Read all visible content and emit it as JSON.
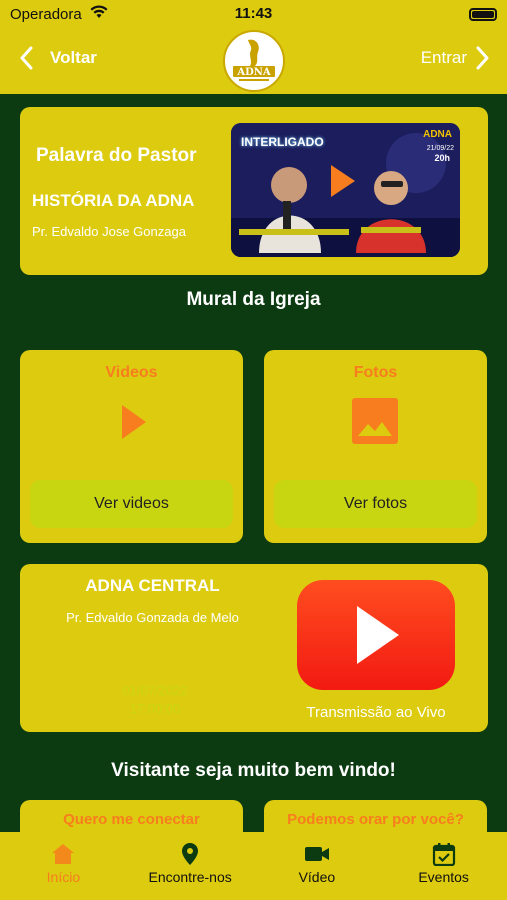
{
  "status_bar": {
    "carrier": "Operadora",
    "time": "11:43"
  },
  "header": {
    "back_label": "Voltar",
    "enter_label": "Entrar",
    "logo_text": "ADNA"
  },
  "pastor_card": {
    "title": "Palavra do Pastor",
    "subtitle": "HISTÓRIA DA ADNA",
    "pastor": "Pr. Edvaldo Jose Gonzaga",
    "thumbnail_text": "INTERLIGADO",
    "thumbnail_badge_top": "ADNA",
    "thumbnail_date": "21/09/22",
    "thumbnail_hour": "20h"
  },
  "mural_title": "Mural da Igreja",
  "videos_card": {
    "label": "Videos",
    "button": "Ver videos"
  },
  "fotos_card": {
    "label": "Fotos",
    "button": "Ver fotos"
  },
  "central_card": {
    "title": "ADNA CENTRAL",
    "pastor": "Pr. Edvaldo Gonzada de Melo",
    "date": "01/07/2022",
    "time": "17:00:00",
    "live_label": "Transmissão ao Vivo"
  },
  "welcome": "Visitante seja muito bem vindo!",
  "connect_card": {
    "label": "Quero me conectar"
  },
  "pray_card": {
    "label": "Podemos orar por você?"
  },
  "tabs": [
    {
      "label": "Início",
      "icon": "home-icon",
      "active": true
    },
    {
      "label": "Encontre-nos",
      "icon": "location-pin-icon"
    },
    {
      "label": "Vídeo",
      "icon": "video-camera-icon"
    },
    {
      "label": "Eventos",
      "icon": "calendar-icon"
    }
  ],
  "colors": {
    "background": "#0c3b12",
    "card": "#ddcb10",
    "accent": "#f77d1e",
    "button": "#c8d511",
    "live_red": "#f21a12"
  }
}
